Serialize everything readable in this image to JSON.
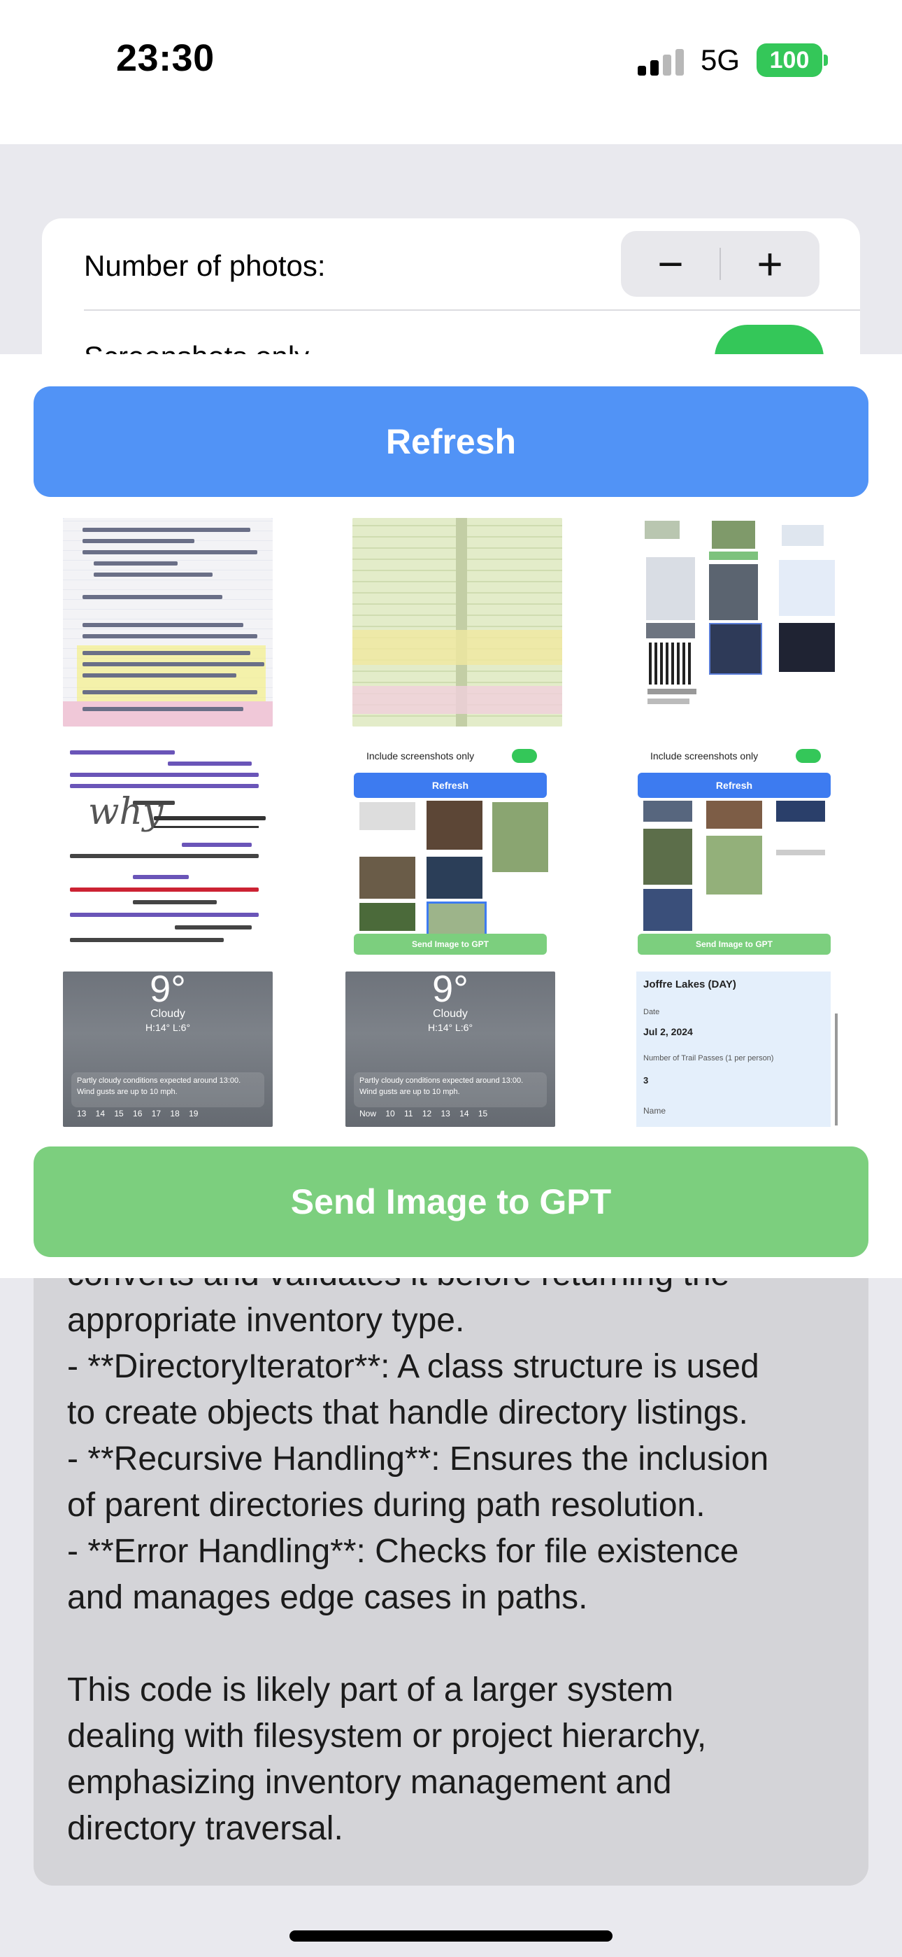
{
  "status_bar": {
    "time": "23:30",
    "network": "5G",
    "battery": "100"
  },
  "settings": {
    "photos_label": "Number of photos:",
    "minus_label": "−",
    "plus_label": "+",
    "screenshots_label": "Screenshots only",
    "screenshots_only": true
  },
  "refresh_label": "Refresh",
  "send_label": "Send Image to GPT",
  "thumbnails": {
    "mini_toggle_label": "Include screenshots only",
    "mini_refresh": "Refresh",
    "mini_send": "Send Image to GPT",
    "weather_temp": "9°",
    "weather_condition": "Cloudy",
    "weather_hilo": "H:14° L:6°",
    "weather_note_1": "Partly cloudy conditions expected around 13:00.",
    "weather_note_2": "Wind gusts are up to 10 mph.",
    "weather_hours_a": "13    14    15    16    17    18    19",
    "weather_hours_b": "Now    10    11    12    13    14    15",
    "form_title": "Joffre Lakes (DAY)",
    "form_date_label": "Date",
    "form_date": "Jul 2, 2024",
    "form_passes_label": "Number of Trail Passes (1 per person)",
    "form_passes": "3",
    "form_name_label": "Name",
    "handwriting": "why"
  },
  "response": {
    "lines": [
      "converts and validates it before returning the",
      "appropriate inventory type.",
      "- **DirectoryIterator**: A class structure is used",
      "to create objects that handle directory listings.",
      "- **Recursive Handling**: Ensures the inclusion",
      "of parent directories during path resolution.",
      "- **Error Handling**: Checks for file existence",
      "and manages edge cases in paths.",
      "",
      "This code is likely part of a larger system",
      "dealing with filesystem or project hierarchy,",
      "emphasizing inventory management and",
      "directory traversal."
    ]
  },
  "colors": {
    "accent_blue": "#5193f6",
    "accent_green": "#7ccf7e",
    "toggle_green": "#34c759"
  }
}
